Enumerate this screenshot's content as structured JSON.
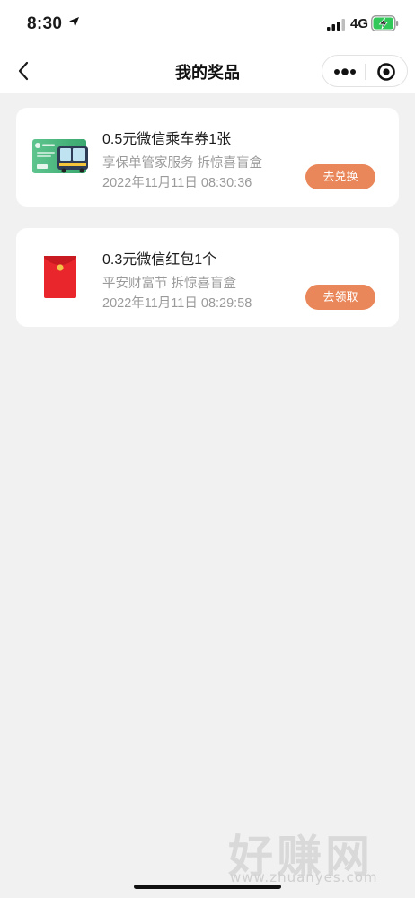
{
  "status_bar": {
    "time": "8:30",
    "network": "4G",
    "icons": [
      "location-arrow-icon",
      "signal-icon",
      "battery-charging-icon"
    ]
  },
  "nav": {
    "title": "我的奖品",
    "icons": [
      "back-chevron-icon",
      "more-dots-icon",
      "target-close-icon"
    ]
  },
  "prizes": [
    {
      "name": "0.5元微信乘车券1张",
      "source": "享保单管家服务 拆惊喜盲盒",
      "time": "2022年11月11日 08:30:36",
      "action": "去兑换",
      "thumb_icon": "bus-ticket-icon"
    },
    {
      "name": "0.3元微信红包1个",
      "source": "平安财富节 拆惊喜盲盒",
      "time": "2022年11月11日 08:29:58",
      "action": "去领取",
      "thumb_icon": "red-envelope-icon"
    }
  ],
  "watermark": {
    "main": "好赚网",
    "sub": "www.zhuanyes.com"
  },
  "colors": {
    "background": "#f1f1f1",
    "card": "#ffffff",
    "action_button": "#e9875a",
    "secondary_text": "#9a9a9a",
    "red_envelope": "#e8262c"
  }
}
